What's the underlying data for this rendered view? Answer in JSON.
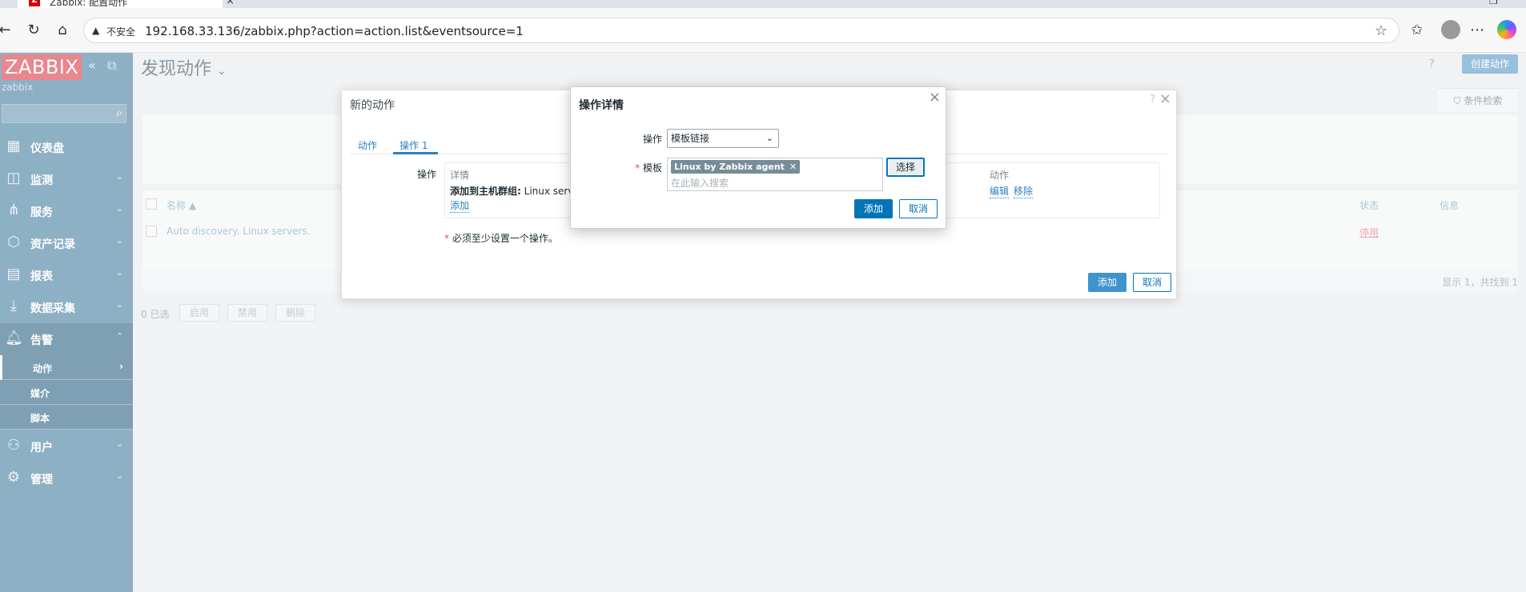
{
  "browser": {
    "tab_title": "Zabbix: 配置动作",
    "address_warning": "不安全",
    "url": "192.168.33.136/zabbix.php?action=action.list&eventsource=1"
  },
  "sidebar": {
    "logo": "ZABBIX",
    "server_name": "zabbix",
    "search_placeholder": "",
    "items": [
      {
        "label": "仪表盘",
        "icon": "dashboard-icon"
      },
      {
        "label": "监测",
        "icon": "monitoring-icon"
      },
      {
        "label": "服务",
        "icon": "services-icon"
      },
      {
        "label": "资产记录",
        "icon": "inventory-icon"
      },
      {
        "label": "报表",
        "icon": "reports-icon"
      },
      {
        "label": "数据采集",
        "icon": "data-collection-icon"
      },
      {
        "label": "告警",
        "icon": "alerts-icon"
      },
      {
        "label": "用户",
        "icon": "users-icon"
      },
      {
        "label": "管理",
        "icon": "administration-icon"
      }
    ],
    "alerts_submenu": [
      {
        "label": "动作"
      },
      {
        "label": "媒介"
      },
      {
        "label": "脚本"
      }
    ]
  },
  "page": {
    "title": "发现动作",
    "create_button": "创建动作",
    "filter_tab": "条件检索",
    "help": "?",
    "table": {
      "headers": {
        "name": "名称 ▲",
        "status": "状态",
        "info": "信息"
      },
      "rows": [
        {
          "name": "Auto discovery. Linux servers.",
          "status": "停用"
        }
      ]
    },
    "pager_text": "显示 1，共找到 1",
    "selected_count": "0 已选",
    "mass_buttons": [
      "启用",
      "禁用",
      "删除"
    ]
  },
  "action_modal": {
    "title": "新的动作",
    "help": "?",
    "tabs": [
      {
        "label": "动作"
      },
      {
        "label": "操作",
        "count": "1"
      }
    ],
    "operations_label": "操作",
    "columns": {
      "details": "详情",
      "actions": "动作"
    },
    "operation_row": {
      "prefix": "添加到主机群组:",
      "value": "Linux serve"
    },
    "edit_link": "编辑",
    "remove_link": "移除",
    "add_link": "添加",
    "note_star": "*",
    "note_text": "必须至少设置一个操作。",
    "add_button": "添加",
    "cancel_button": "取消"
  },
  "operation_modal": {
    "title": "操作详情",
    "operation_label": "操作",
    "operation_value": "模板链接",
    "template_label": "模板",
    "required_mark": "*",
    "selected_template": "Linux by Zabbix agent",
    "search_placeholder": "在此输入搜索",
    "choose_button": "选择",
    "add_button": "添加",
    "cancel_button": "取消"
  }
}
